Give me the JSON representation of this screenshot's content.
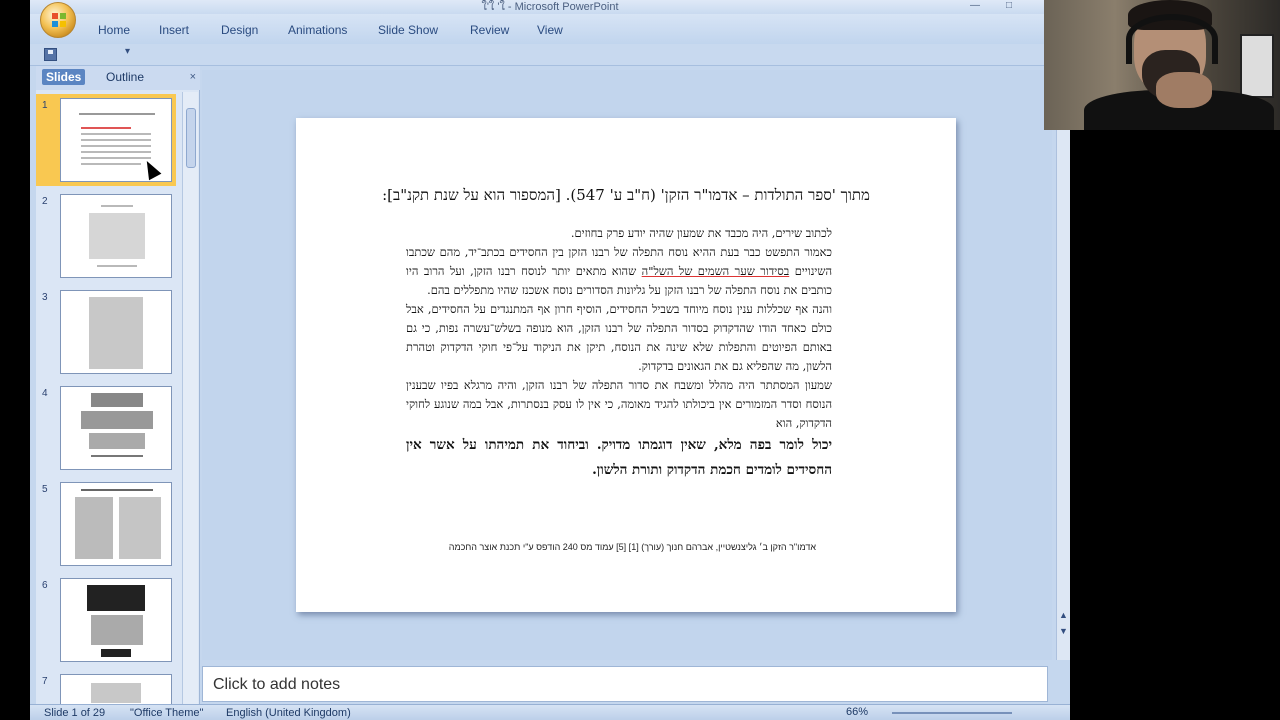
{
  "app": {
    "window_title": "ใ'ใ 'ใ - Microsoft PowerPoint"
  },
  "ribbon": {
    "tabs": [
      "Home",
      "Insert",
      "Design",
      "Animations",
      "Slide Show",
      "Review",
      "View"
    ]
  },
  "left_panel": {
    "tab_slides": "Slides",
    "tab_outline": "Outline",
    "close": "×",
    "slide_numbers": [
      "1",
      "2",
      "3",
      "4",
      "5",
      "6",
      "7"
    ]
  },
  "slide": {
    "title": "מתוך 'ספר התולדות – אדמו\"ר הזקן' (ח\"ב ע' 547). [המספור הוא על שנת תקנ\"ב]:",
    "p1": "לכתוב שירים, היה מכבד את שמעון שהיה יודע פרק בחוזים.",
    "p2a": "כאמור התפשט כבר בעת ההיא נוסח התפלה של רבנו הזקן בין החסידים בכתב־יד, מהם שכתבו השינויים ",
    "p2u": "בסידור שער השמים של השל\"ה",
    "p2b": " שהוא מתאים יותר לנוסח רבנו הזקן, ועל הרוב היו כותבים את נוסח התפלה של רבנו הזקן על גליונות הסדורים נוסח אשכנז שהיו מתפללים בהם.",
    "p3": "והנה אף שכללות ענין נוסח מיוחד בשביל החסידים, הוסיף חרון אף המתנגדים על החסידים, אבל כולם כאחד הודו שהדקדוק בסדור התפלה של רבנו הזקן, הוא מנופה בשלש־עשרה נפות, כי גם באותם הפיוטים והתפלות שלא שינה את הנוסח, תיקן את הניקוד על־פי חוקי הדקדוק וטהרת הלשון, מה שהפליא גם את הגאונים בדקדוק.",
    "p4": "שמעון המסתתר היה מהלל ומשבח את סדור התפלה של רבנו הזקן, והיה מרגלא בפיו שבענין הנוסח וסדר המזמורים אין ביכולתו להגיד מאומה, כי אין לו עסק בנסתרות, אבל במה שנוגע לחוקי הדקדוק, הוא",
    "p5": "יכול לומר בפה מלא, שאין דוגמתו מדויק. וביחוד את תמיהתו על אשר אין החסידים לומדים חכמת הדקדוק ותורת הלשון.",
    "source": "אדמו\"ר הזקן ב׳ גליצנשטיין, אברהם חנוך (עורך) [1] [5] עמוד מס 240 הודפס ע\"י תכנת אוצר החכמה"
  },
  "notes": {
    "placeholder": "Click to add notes"
  },
  "status": {
    "slide": "Slide 1 of 29",
    "theme": "\"Office Theme\"",
    "language": "English (United Kingdom)",
    "zoom": "66%"
  }
}
